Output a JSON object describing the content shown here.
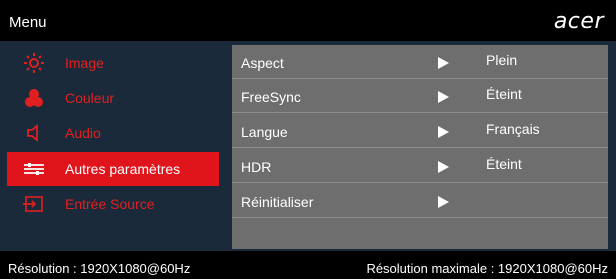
{
  "header": {
    "title": "Menu",
    "brand": "acer"
  },
  "sidebar": {
    "items": [
      {
        "label": "Image",
        "icon": "brightness-sun-icon",
        "active": false
      },
      {
        "label": "Couleur",
        "icon": "color-dots-icon",
        "active": false
      },
      {
        "label": "Audio",
        "icon": "speaker-icon",
        "active": false
      },
      {
        "label": "Autres paramètres",
        "icon": "settings-sliders-icon",
        "active": true
      },
      {
        "label": "Entrée Source",
        "icon": "input-source-icon",
        "active": false
      }
    ]
  },
  "settings": {
    "rows": [
      {
        "label": "Aspect",
        "value": "Plein"
      },
      {
        "label": "FreeSync",
        "value": "Éteint"
      },
      {
        "label": "Langue",
        "value": "Français"
      },
      {
        "label": "HDR",
        "value": "Éteint"
      },
      {
        "label": "Réinitialiser",
        "value": ""
      }
    ]
  },
  "footer": {
    "resolution": "Résolution : 1920X1080@60Hz",
    "max_resolution": "Résolution maximale : 1920X1080@60Hz"
  },
  "colors": {
    "accent": "#e0141b",
    "sidebar_bg": "#1b2a3a",
    "content_bg": "#6e6e6e",
    "inactive_label": "#e02020"
  }
}
